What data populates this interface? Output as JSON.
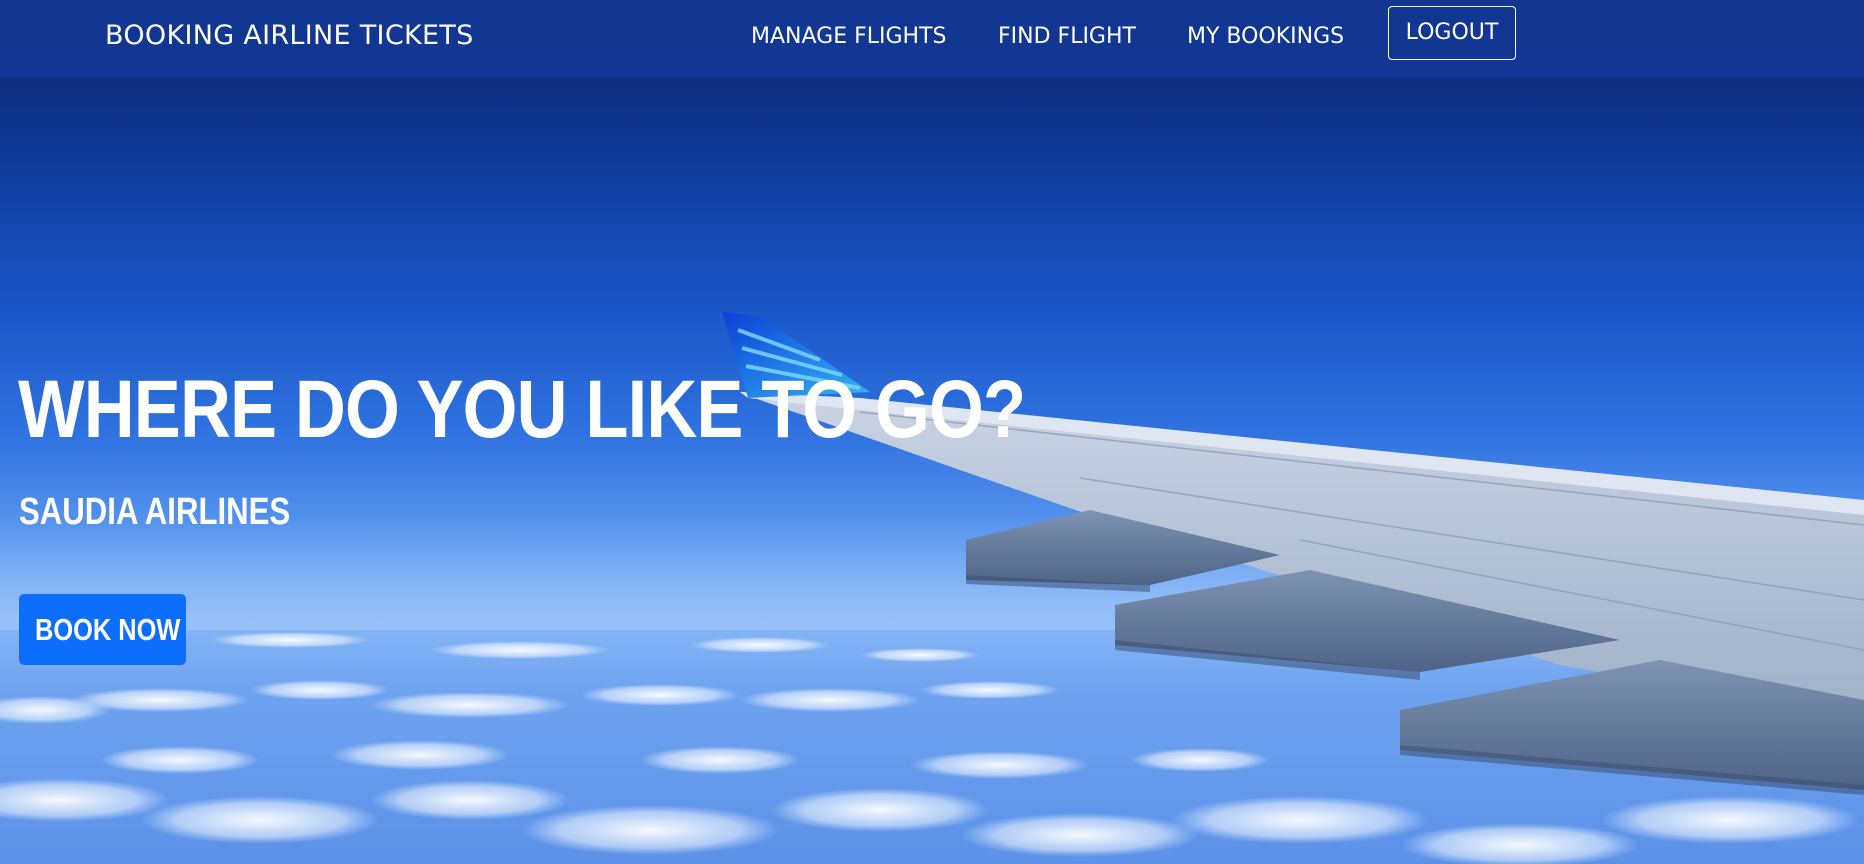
{
  "navbar": {
    "brand": "BOOKING AIRLINE TICKETS",
    "links": [
      {
        "label": "MANAGE FLIGHTS"
      },
      {
        "label": "FIND FLIGHT"
      },
      {
        "label": "MY BOOKINGS"
      }
    ],
    "logout_label": "LOGOUT"
  },
  "hero": {
    "title": "WHERE DO YOU LIKE TO GO?",
    "subtitle": "SAUDIA AIRLINES",
    "cta_label": "BOOK NOW"
  },
  "colors": {
    "navbar_bg": "#143896",
    "primary_button": "#0d6efd",
    "text": "#ffffff"
  }
}
